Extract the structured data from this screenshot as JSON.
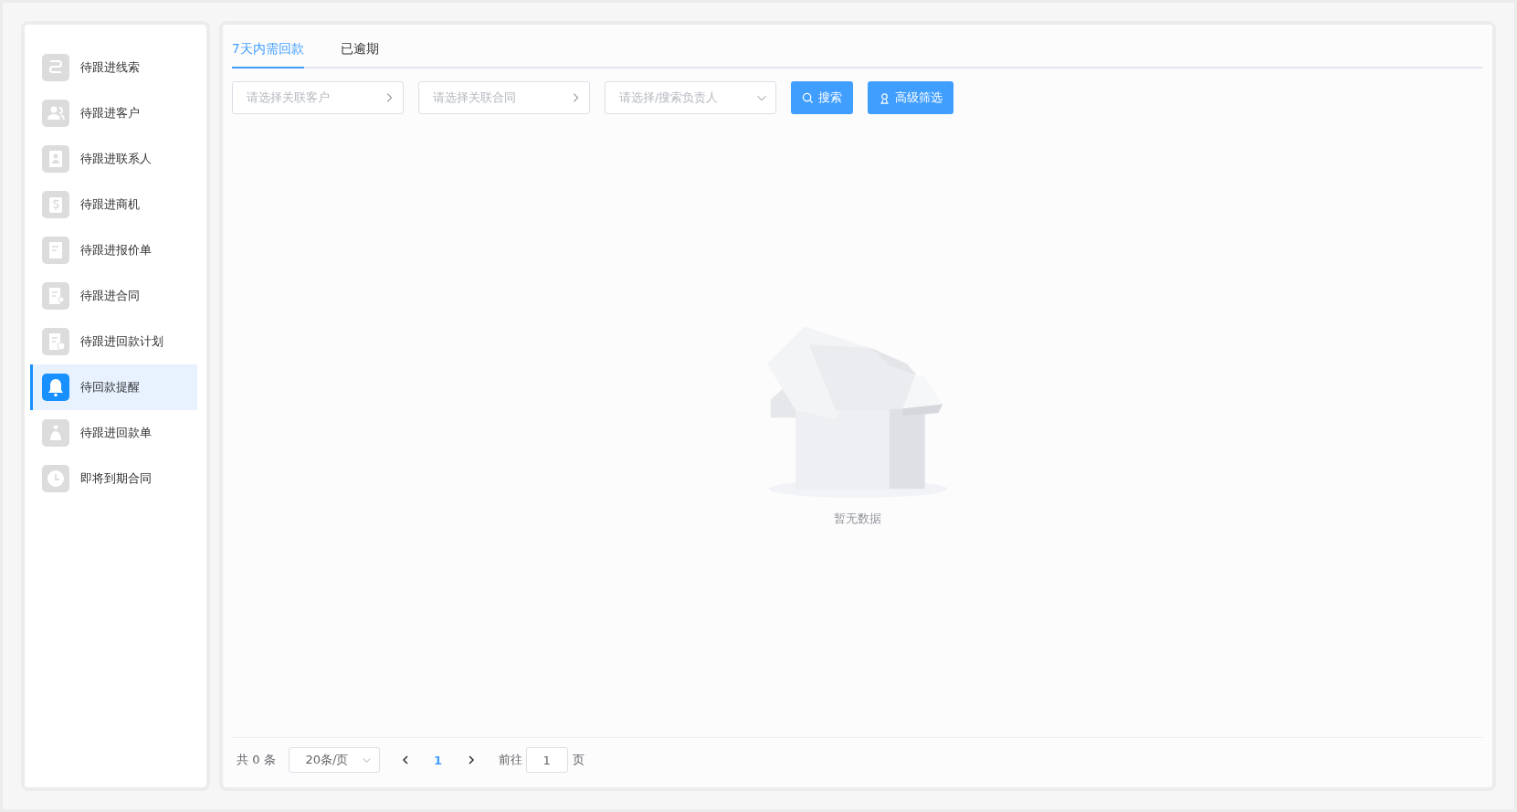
{
  "sidebar": {
    "items": [
      {
        "label": "待跟进线索",
        "selected": false
      },
      {
        "label": "待跟进客户",
        "selected": false
      },
      {
        "label": "待跟进联系人",
        "selected": false
      },
      {
        "label": "待跟进商机",
        "selected": false
      },
      {
        "label": "待跟进报价单",
        "selected": false
      },
      {
        "label": "待跟进合同",
        "selected": false
      },
      {
        "label": "待跟进回款计划",
        "selected": false
      },
      {
        "label": "待回款提醒",
        "selected": true
      },
      {
        "label": "待跟进回款单",
        "selected": false
      },
      {
        "label": "即将到期合同",
        "selected": false
      }
    ]
  },
  "tabs": [
    {
      "label": "7天内需回款",
      "selected": true
    },
    {
      "label": "已逾期",
      "selected": false
    }
  ],
  "filters": [
    {
      "kind": "picker",
      "placeholder": "请选择关联客户"
    },
    {
      "kind": "picker",
      "placeholder": "请选择关联合同"
    },
    {
      "kind": "select",
      "placeholder": "请选择/搜索负责人"
    }
  ],
  "buttons": [
    {
      "kind": "search",
      "label": "搜索"
    },
    {
      "kind": "filter",
      "label": "高级筛选"
    }
  ],
  "empty": {
    "text": "暂无数据"
  },
  "pagination": {
    "total": "共 0 条",
    "page_size": "20条/页",
    "pages": [
      {
        "label": "1",
        "selected": true
      }
    ],
    "goto_label": "前往",
    "goto_value": "1",
    "goto_suffix": "页"
  }
}
